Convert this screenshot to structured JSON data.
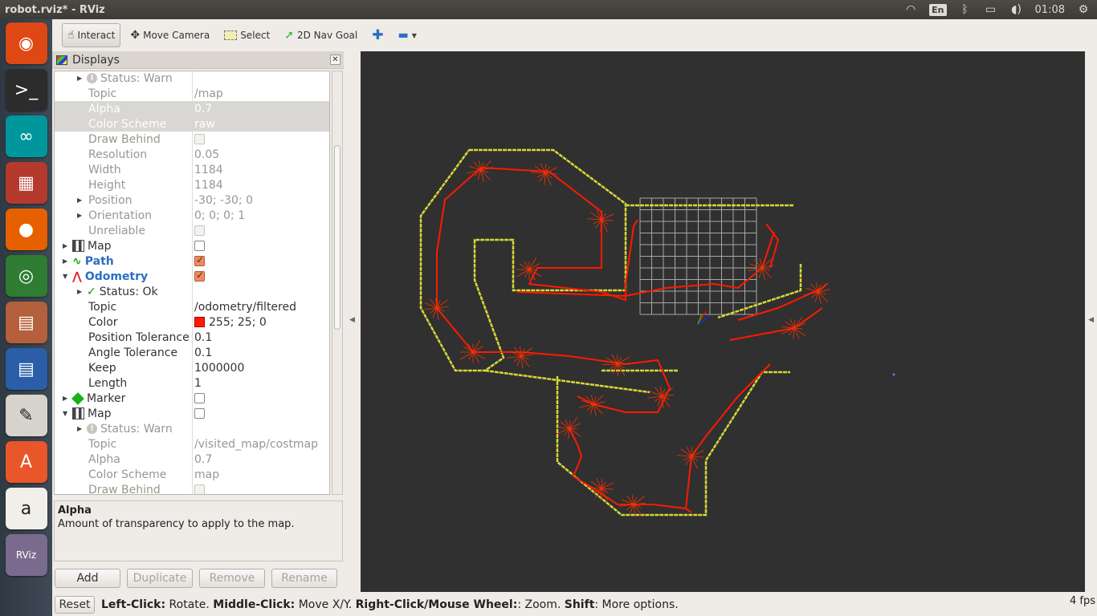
{
  "window": {
    "title": "robot.rviz* - RViz"
  },
  "tray": {
    "lang": "En",
    "time": "01:08"
  },
  "launcher": [
    {
      "name": "ubuntu-dash-icon",
      "glyph": "◉",
      "color": "#dd4814"
    },
    {
      "name": "terminal-icon",
      "glyph": ">_",
      "color": "#2c2c2c"
    },
    {
      "name": "arduino-icon",
      "glyph": "∞",
      "color": "#00979c"
    },
    {
      "name": "workspace-switcher-icon",
      "glyph": "▦",
      "color": "#b53a2e"
    },
    {
      "name": "firefox-icon",
      "glyph": "●",
      "color": "#e66000"
    },
    {
      "name": "chrome-icon",
      "glyph": "◎",
      "color": "#2e7d32"
    },
    {
      "name": "files-icon",
      "glyph": "▤",
      "color": "#b5603c"
    },
    {
      "name": "writer-icon",
      "glyph": "▤",
      "color": "#2a5ea8"
    },
    {
      "name": "text-editor-icon",
      "glyph": "✎",
      "color": "#d6d3cc"
    },
    {
      "name": "software-center-icon",
      "glyph": "A",
      "color": "#e8562a"
    },
    {
      "name": "amazon-icon",
      "glyph": "a",
      "color": "#f1efe9"
    },
    {
      "name": "rviz-icon",
      "glyph": "RViz",
      "color": "#7a6b8e"
    }
  ],
  "toolbar": {
    "interact": "Interact",
    "move_camera": "Move Camera",
    "select": "Select",
    "nav_goal": "2D Nav Goal"
  },
  "displays": {
    "title": "Displays",
    "rows": [
      {
        "indent": 1,
        "arrow": "▶",
        "icon": "warn",
        "name": "Status: Warn",
        "value": "",
        "dim": true
      },
      {
        "indent": 1,
        "name": "Topic",
        "value": "/map",
        "dim": true
      },
      {
        "indent": 1,
        "name": "Alpha",
        "value": "0.7",
        "sel": true
      },
      {
        "indent": 1,
        "name": "Color Scheme",
        "value": "raw",
        "sel": true
      },
      {
        "indent": 1,
        "name": "Draw Behind",
        "value": "",
        "check": "dim",
        "dim": true
      },
      {
        "indent": 1,
        "name": "Resolution",
        "value": "0.05",
        "dim": true
      },
      {
        "indent": 1,
        "name": "Width",
        "value": "1184",
        "dim": true
      },
      {
        "indent": 1,
        "name": "Height",
        "value": "1184",
        "dim": true
      },
      {
        "indent": 1,
        "arrow": "▶",
        "name": "Position",
        "value": "-30; -30; 0",
        "dim": true
      },
      {
        "indent": 1,
        "arrow": "▶",
        "name": "Orientation",
        "value": "0; 0; 0; 1",
        "dim": true
      },
      {
        "indent": 1,
        "name": "Unreliable",
        "value": "",
        "check": "dim",
        "dim": true
      },
      {
        "indent": 0,
        "arrow": "▶",
        "icon": "map",
        "name": "Map",
        "value": "",
        "check": "off"
      },
      {
        "indent": 0,
        "arrow": "▶",
        "icon": "path",
        "name": "Path",
        "value": "",
        "check": "on",
        "blue": true
      },
      {
        "indent": 0,
        "arrow": "▼",
        "icon": "odom",
        "name": "Odometry",
        "value": "",
        "check": "on",
        "blue": true
      },
      {
        "indent": 1,
        "arrow": "▶",
        "icon": "ok",
        "name": "Status: Ok",
        "value": ""
      },
      {
        "indent": 1,
        "name": "Topic",
        "value": "/odometry/filtered"
      },
      {
        "indent": 1,
        "name": "Color",
        "value": "255; 25; 0",
        "color": "#ff1900"
      },
      {
        "indent": 1,
        "name": "Position Tolerance",
        "value": "0.1"
      },
      {
        "indent": 1,
        "name": "Angle Tolerance",
        "value": "0.1"
      },
      {
        "indent": 1,
        "name": "Keep",
        "value": "1000000"
      },
      {
        "indent": 1,
        "name": "Length",
        "value": "1"
      },
      {
        "indent": 0,
        "arrow": "▶",
        "icon": "marker",
        "name": "Marker",
        "value": "",
        "check": "off"
      },
      {
        "indent": 0,
        "arrow": "▼",
        "icon": "map",
        "name": "Map",
        "value": "",
        "check": "off"
      },
      {
        "indent": 1,
        "arrow": "▶",
        "icon": "warn",
        "name": "Status: Warn",
        "value": "",
        "dim": true
      },
      {
        "indent": 1,
        "name": "Topic",
        "value": "/visited_map/costmap",
        "dim": true
      },
      {
        "indent": 1,
        "name": "Alpha",
        "value": "0.7",
        "dim": true
      },
      {
        "indent": 1,
        "name": "Color Scheme",
        "value": "map",
        "dim": true
      },
      {
        "indent": 1,
        "name": "Draw Behind",
        "value": "",
        "check": "dim",
        "dim": true
      }
    ],
    "desc_title": "Alpha",
    "desc_text": "Amount of transparency to apply to the map.",
    "buttons": {
      "add": "Add",
      "duplicate": "Duplicate",
      "remove": "Remove",
      "rename": "Rename"
    }
  },
  "statusbar": {
    "reset": "Reset",
    "b1": "Left-Click:",
    "t1": " Rotate. ",
    "b2": "Middle-Click:",
    "t2": " Move X/Y. ",
    "b3": "Right-Click/Mouse Wheel:",
    "t3": ": Zoom. ",
    "b4": "Shift",
    "t4": ": More options.",
    "fps": "4 fps"
  },
  "colors": {
    "map_wall": "#d8d838",
    "path": "#ff1900",
    "grid": "#a0a0a0",
    "background": "#303030"
  }
}
